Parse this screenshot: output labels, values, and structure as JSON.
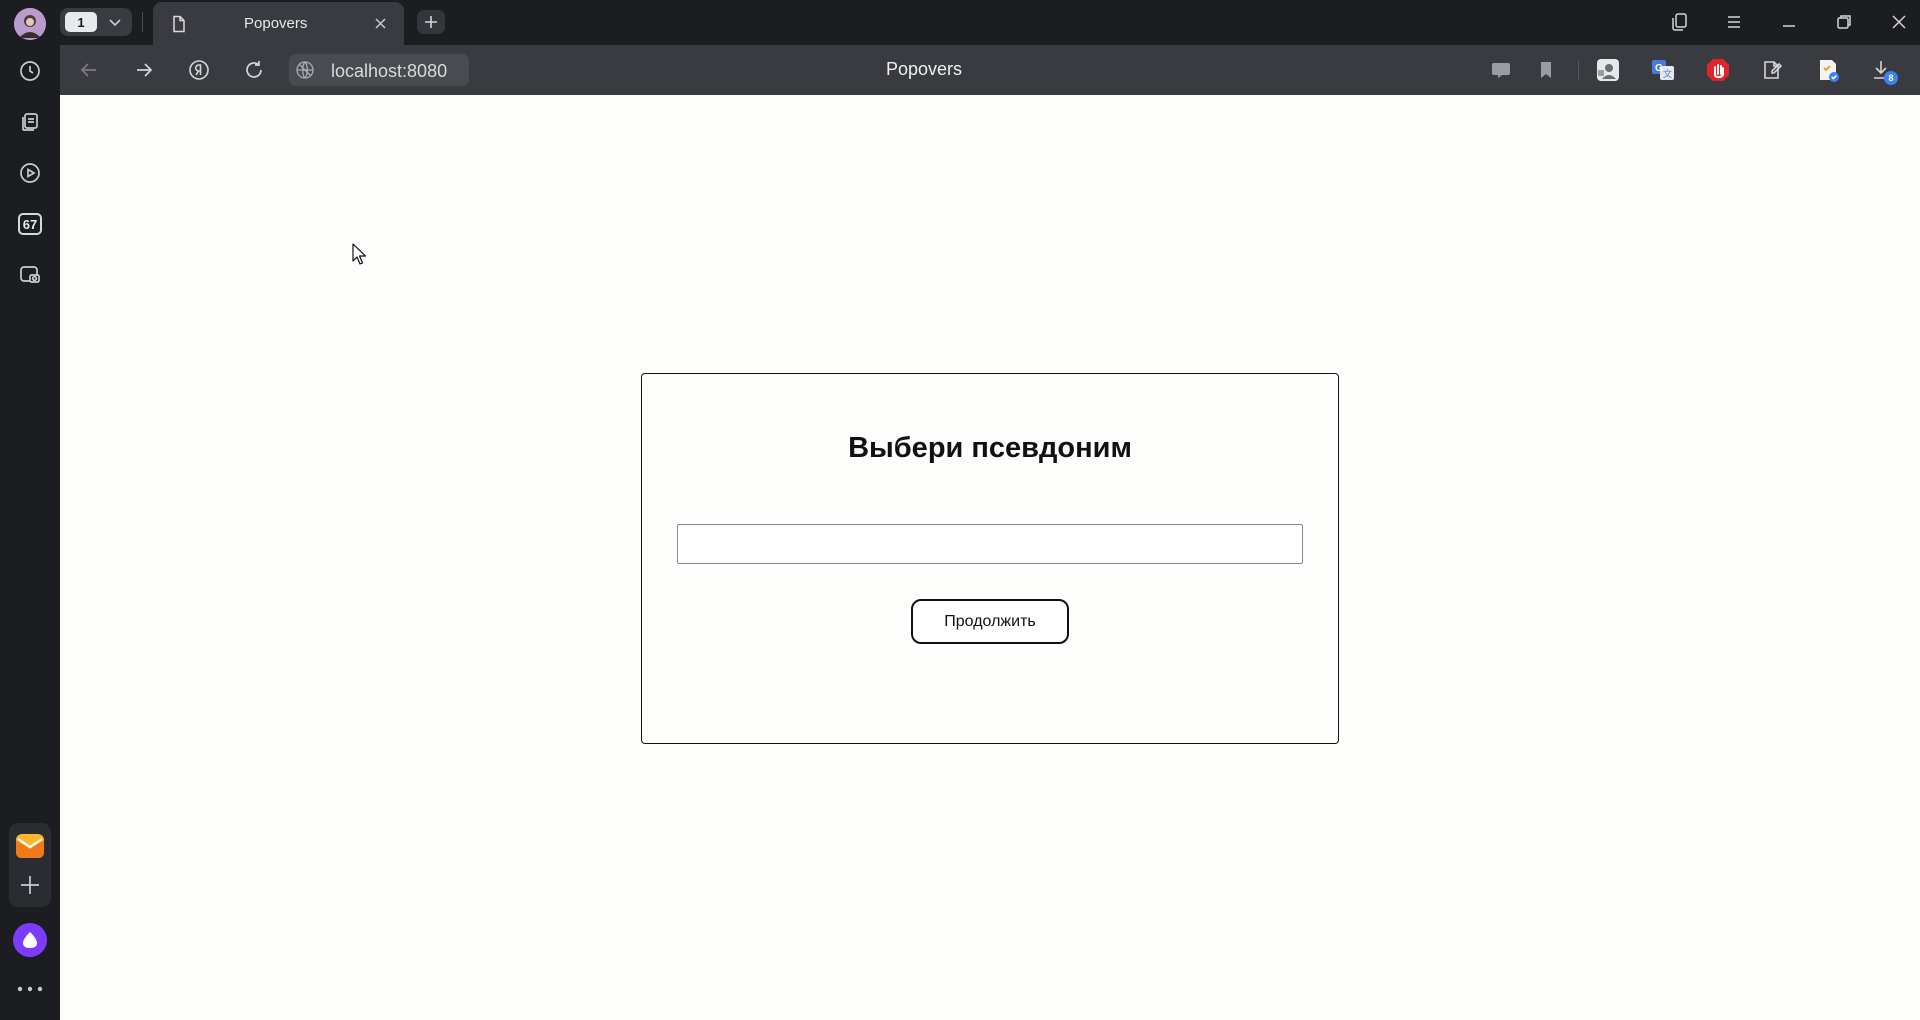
{
  "browser": {
    "tab_count": "1",
    "active_tab": {
      "title": "Popovers"
    },
    "url": "localhost:8080",
    "page_title": "Popovers"
  },
  "sidebar": {
    "counter_badge": "67",
    "icons": [
      "history-icon",
      "collections-icon",
      "video-icon",
      "counter-badge-icon",
      "screenshot-icon",
      "mail-app-icon",
      "add-icon",
      "alice-assistant-icon",
      "more-icon"
    ]
  },
  "extensions": {
    "downloads_count": "8",
    "icons": [
      "chat-icon",
      "bookmark-icon",
      "profile-ext-icon",
      "translate-icon",
      "adblock-icon",
      "notes-icon",
      "checklist-icon",
      "download-icon"
    ]
  },
  "page": {
    "heading": "Выбери псевдоним",
    "nickname_input": {
      "value": "",
      "placeholder": ""
    },
    "continue_button": "Продолжить"
  },
  "colors": {
    "chrome_dark": "#1c1d21",
    "toolbar": "#3a3b40",
    "page_background": "#fdfdfb",
    "adblock_red": "#e0242b",
    "translate_blue": "#4a7ad8",
    "alice_purple": "#7c3cff"
  }
}
